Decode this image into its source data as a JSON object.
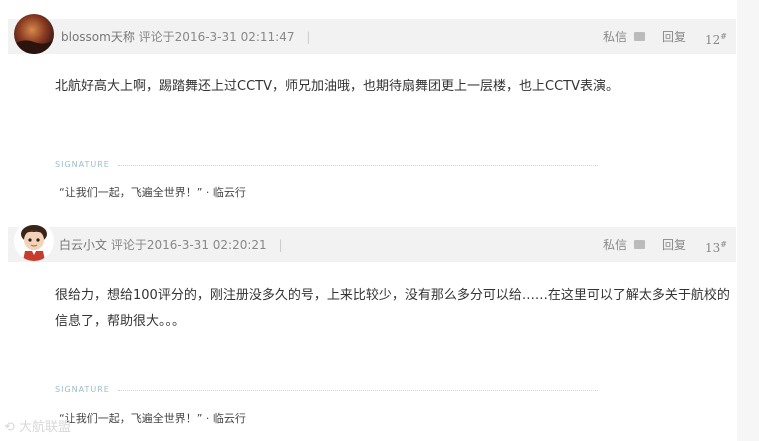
{
  "posts": [
    {
      "username": "blossom天称",
      "comment_time": "评论于2016-3-31 02:11:47",
      "separator": "|",
      "private_message_label": "私信",
      "reply_label": "回复",
      "floor_number": "12",
      "floor_mark": "#",
      "content": "北航好高大上啊，踢踏舞还上过CCTV，师兄加油哦，也期待扇舞团更上一层楼，也上CCTV表演。",
      "signature_label": "SIGNATURE",
      "signature_text": "“让我们一起，飞遍全世界！” · 临云行"
    },
    {
      "username": "白云小文",
      "comment_time": "评论于2016-3-31 02:20:21",
      "separator": "|",
      "private_message_label": "私信",
      "reply_label": "回复",
      "floor_number": "13",
      "floor_mark": "#",
      "content": "很给力，想给100评分的，刚注册没多久的号，上来比较少，没有那么多分可以给……在这里可以了解太多关于航校的信息了，帮助很大。。。",
      "signature_label": "SIGNATURE",
      "signature_text": "“让我们一起，飞遍全世界！” · 临云行"
    }
  ],
  "watermark": "大航联盟",
  "colors": {
    "header_bg": "#f2f2f2",
    "signature_label": "#9bbcd0"
  }
}
